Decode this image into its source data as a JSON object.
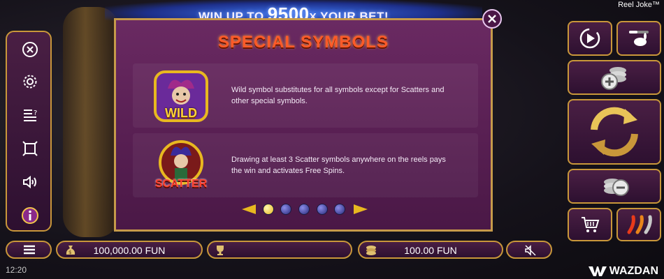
{
  "banner": {
    "prefix": "WIN UP TO",
    "amount": "9500",
    "multiplier": "X",
    "suffix": "YOUR BET!"
  },
  "game_title": "Reel Joke™",
  "dialog": {
    "title": "SPECIAL SYMBOLS",
    "symbols": [
      {
        "label": "WILD",
        "description": "Wild symbol substitutes for all symbols except for Scatters and other special symbols."
      },
      {
        "label": "SCATTER",
        "description": "Drawing at least 3 Scatter symbols anywhere on the reels pays the win and activates Free Spins."
      }
    ],
    "pages": {
      "total": 5,
      "current": 1
    }
  },
  "left_menu": [
    "close-icon",
    "gear-icon",
    "paytable-icon",
    "fullscreen-icon",
    "sound-icon",
    "info-icon"
  ],
  "bottom_bar": {
    "balance": "100,000.00 FUN",
    "bet": "100.00 FUN"
  },
  "status": {
    "clock": "12:20",
    "brand": "WAZDAN"
  },
  "colors": {
    "panel": "#4a1f44",
    "border": "#c9973a",
    "title": "#ff5a28",
    "accent": "#e8b820"
  }
}
